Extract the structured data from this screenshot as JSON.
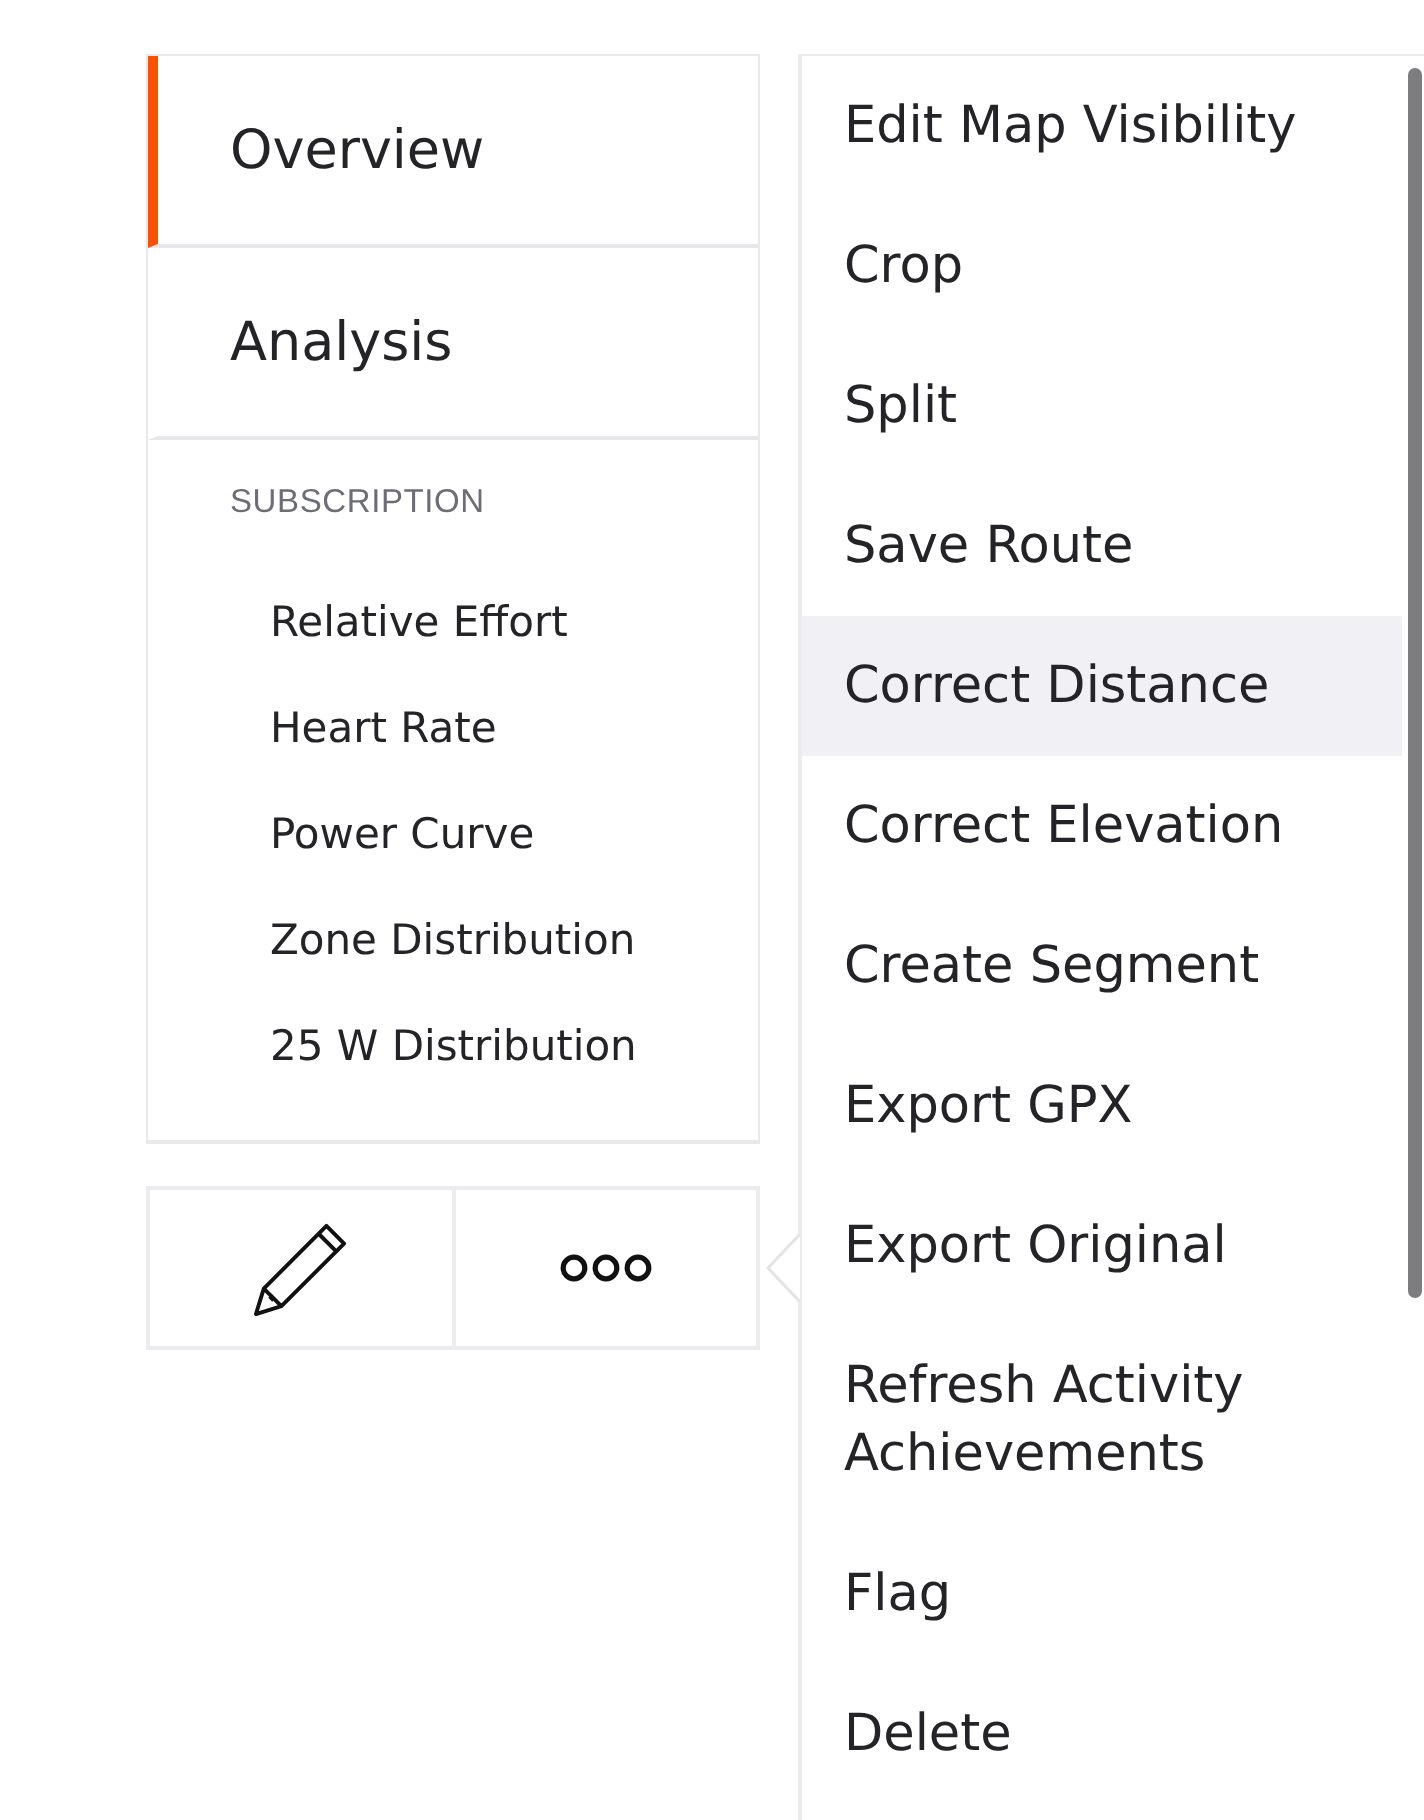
{
  "tabs": [
    {
      "label": "Overview",
      "selected": true
    },
    {
      "label": "Analysis",
      "selected": false
    }
  ],
  "subscription": {
    "heading": "SUBSCRIPTION",
    "items": [
      "Relative Effort",
      "Heart Rate",
      "Power Curve",
      "Zone Distribution",
      "25 W Distribution"
    ]
  },
  "toolbar": [
    {
      "kind": "edit"
    },
    {
      "kind": "more"
    }
  ],
  "menu": {
    "open": true,
    "items": [
      {
        "label": "Edit Map Visibility",
        "highlighted": false
      },
      {
        "label": "Crop",
        "highlighted": false
      },
      {
        "label": "Split",
        "highlighted": false
      },
      {
        "label": "Save Route",
        "highlighted": false
      },
      {
        "label": "Correct Distance",
        "highlighted": true
      },
      {
        "label": "Correct Elevation",
        "highlighted": false
      },
      {
        "label": "Create Segment",
        "highlighted": false
      },
      {
        "label": "Export GPX",
        "highlighted": false
      },
      {
        "label": "Export Original",
        "highlighted": false
      },
      {
        "label": "Refresh Activity Achievements",
        "highlighted": false
      },
      {
        "label": "Flag",
        "highlighted": false
      },
      {
        "label": "Delete",
        "highlighted": false
      }
    ]
  }
}
